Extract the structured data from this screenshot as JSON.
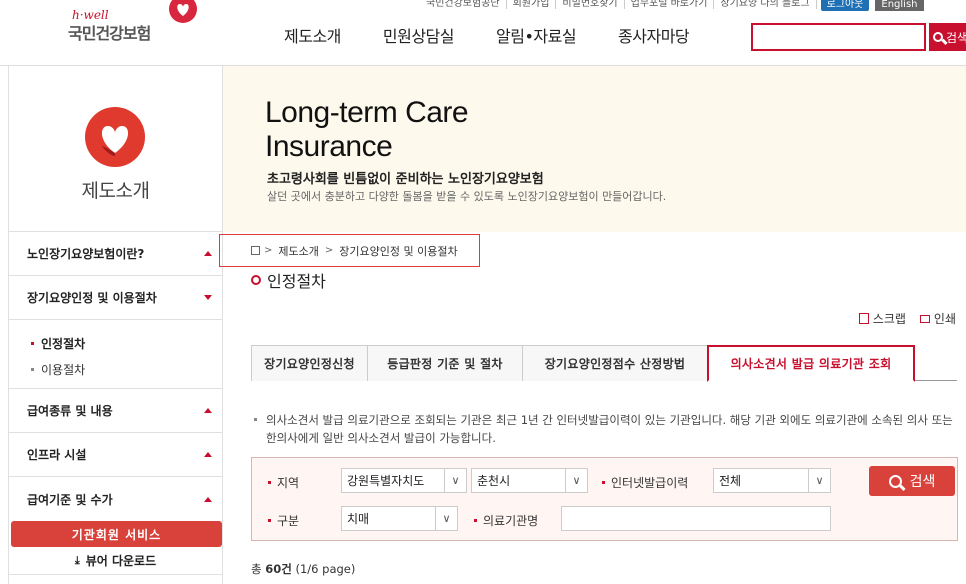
{
  "util_links": [
    "국민건강보험공단",
    "회원가입",
    "비밀번호찾기",
    "업무포털 바로가기",
    "장기요양 나의 블로그"
  ],
  "util_login": "로그아웃",
  "util_english": "English",
  "logo": {
    "tagline": "h·well",
    "name": "국민건강보험"
  },
  "gnb": [
    "제도소개",
    "민원상담실",
    "알림•자료실",
    "종사자마당"
  ],
  "header_search": {
    "button": "검색"
  },
  "sidebar": {
    "title": "제도소개",
    "menu": [
      {
        "label": "노인장기요양보험이란?",
        "state": "collapsed"
      },
      {
        "label": "장기요양인정 및 이용절차",
        "state": "expanded"
      }
    ],
    "sub": [
      {
        "label": "인정절차",
        "active": true
      },
      {
        "label": "이용절차",
        "active": false
      }
    ],
    "menu2": [
      {
        "label": "급여종류 및 내용"
      },
      {
        "label": "인프라 시설"
      },
      {
        "label": "급여기준 및 수가"
      }
    ],
    "member_button": "기관회원 서비스",
    "viewer_button": "뷰어 다운로드"
  },
  "banner": {
    "title_line1": "Long-term Care",
    "title_line2": "Insurance",
    "subtitle": "초고령사회를 빈틈없이 준비하는 노인장기요양보험",
    "desc": "살던 곳에서 충분하고 다양한 돌봄을 받을 수 있도록 노인장기요양보험이 만들어갑니다."
  },
  "breadcrumb": [
    "제도소개",
    "장기요양인정 및 이용절차"
  ],
  "page_title": "인정절차",
  "tools": {
    "scrap": "스크랩",
    "print": "인쇄"
  },
  "tabs": [
    {
      "label": "장기요양인정신청",
      "active": false
    },
    {
      "label": "등급판정 기준 및 절차",
      "active": false
    },
    {
      "label": "장기요양인정점수 산정방법",
      "active": false
    },
    {
      "label": "의사소견서 발급 의료기관 조회",
      "active": true
    }
  ],
  "note": "의사소견서 발급 의료기관으로 조회되는 기관은 최근 1년 간 인터넷발급이력이 있는 기관입니다. 해당 기관 외에도 의료기관에 소속된 의사 또는 한의사에게 일반 의사소견서 발급이 가능합니다.",
  "form": {
    "region_label": "지역",
    "region_value": "강원특별자치도",
    "city_value": "춘천시",
    "history_label": "인터넷발급이력",
    "history_value": "전체",
    "type_label": "구분",
    "type_value": "치매",
    "hospital_label": "의료기관명",
    "hospital_value": "",
    "search_button": "검색"
  },
  "total": {
    "prefix": "총",
    "count": "60건",
    "pages": "(1/6 page)"
  },
  "colors": {
    "brand_red": "#c8102e",
    "button_red": "#d9413b",
    "banner_bg": "#fdf9ed"
  }
}
